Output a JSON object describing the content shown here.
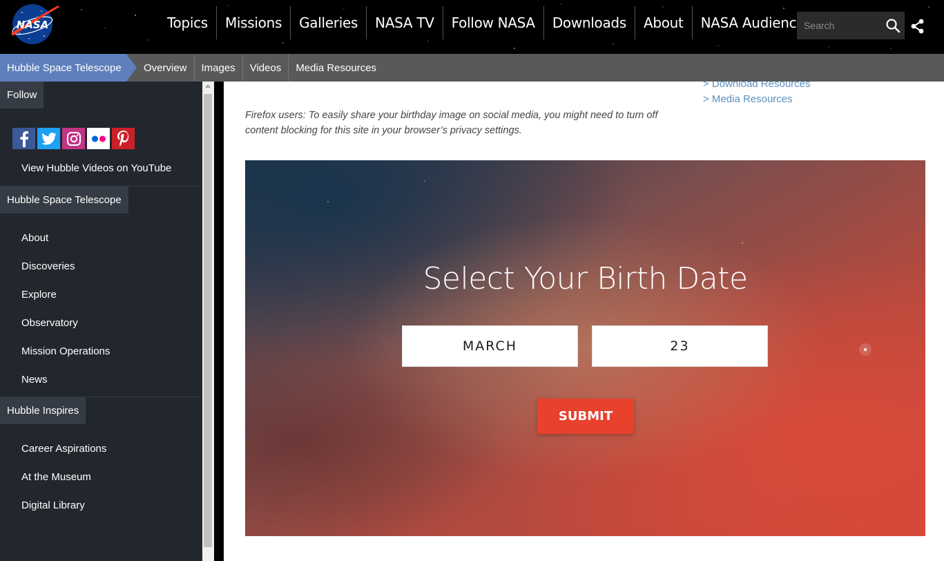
{
  "header": {
    "logo_text": "NASA",
    "nav": [
      "Topics",
      "Missions",
      "Galleries",
      "NASA TV",
      "Follow NASA",
      "Downloads",
      "About",
      "NASA Audiences"
    ],
    "search_placeholder": "Search"
  },
  "subnav": {
    "brand": "Hubble Space Telescope",
    "links": [
      "Overview",
      "Images",
      "Videos",
      "Media Resources"
    ]
  },
  "sidebar": {
    "follow_heading": "Follow",
    "social": [
      "facebook-icon",
      "twitter-icon",
      "instagram-icon",
      "flickr-icon",
      "pinterest-icon"
    ],
    "youtube_link": "View Hubble Videos on YouTube",
    "hst_heading": "Hubble Space Telescope",
    "hst_links": [
      "About",
      "Discoveries",
      "Explore",
      "Observatory",
      "Mission Operations",
      "News"
    ],
    "inspires_heading": "Hubble Inspires",
    "inspires_links": [
      "Career Aspirations",
      "At the Museum",
      "Digital Library"
    ]
  },
  "main": {
    "resources": [
      "> Download Resources",
      "> Media Resources"
    ],
    "firefox_note": "Firefox users: To easily share your birthday image on social media, you might need to turn off content blocking for this site in your browser’s privacy settings.",
    "hero_title": "Select Your Birth Date",
    "month_value": "MARCH",
    "day_value": "23",
    "submit_label": "SUBMIT"
  },
  "colors": {
    "brand_blue": "#5d7fbc",
    "submit_red": "#e8412c",
    "link_blue": "#5b8fbf",
    "sidebar_bg": "#22272e"
  }
}
